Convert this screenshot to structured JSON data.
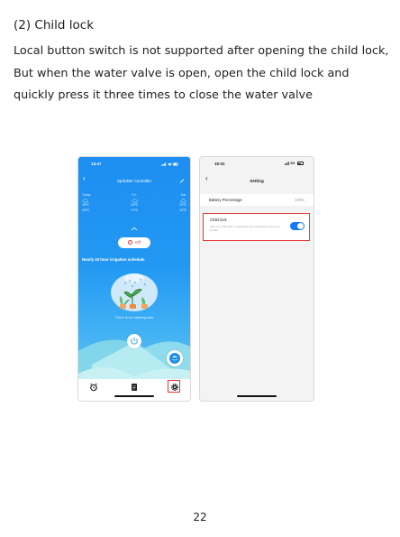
{
  "section": {
    "title": "(2) Child lock",
    "body": "Local button switch is not supported after opening the child lock, But when the water valve is open, open the child lock and quickly press it three times to close the water valve"
  },
  "page_number": "22",
  "phone_left": {
    "status_time": "14:47",
    "nav_title": "Sprinkler controller",
    "forecast": [
      {
        "day": "Today",
        "high": "18℃",
        "low": "16℃"
      },
      {
        "day": "Fri.",
        "high": "18℃",
        "low": "17℃"
      },
      {
        "day": "Sat.",
        "high": "20℃",
        "low": "15℃"
      }
    ],
    "off_label": "Off",
    "schedule_title": "Nearly 24 hour irrigation schedule",
    "empty_text": "There is no watering task",
    "colors": {
      "primary": "#1d8ef2",
      "off_red": "#e53935",
      "highlight": "#e53935"
    },
    "icons": [
      "back-icon",
      "edit-icon",
      "cloud-icon",
      "chevron-up-icon",
      "power-icon",
      "shower-icon",
      "alarm-icon",
      "list-icon",
      "settings-icon"
    ]
  },
  "phone_right": {
    "status_time": "15:02",
    "status_network": "5G",
    "nav_title": "Setting",
    "battery_label": "Battery Percentage",
    "battery_value": "100%",
    "child_lock_title": "Child lock",
    "child_lock_desc": "After the child lock is activated, the local buttons become invalid",
    "child_lock_enabled": true,
    "colors": {
      "toggle_on": "#1677ff",
      "highlight": "#e53935"
    }
  }
}
